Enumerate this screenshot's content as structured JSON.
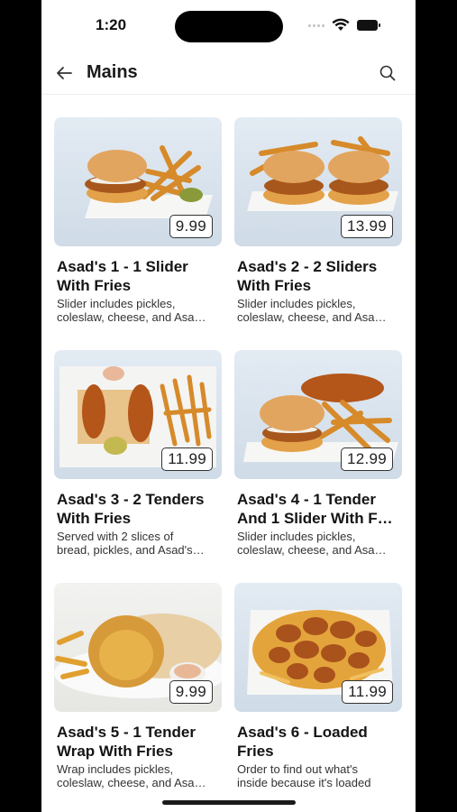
{
  "status_bar": {
    "time": "1:20"
  },
  "header": {
    "title": "Mains"
  },
  "items": [
    {
      "name": "Asad's 1 - 1 Slider\nWith Fries",
      "price": "9.99",
      "description": "Slider includes pickles,\ncoleslaw, cheese, and Asa…"
    },
    {
      "name": "Asad's 2 - 2 Sliders\nWith Fries",
      "price": "13.99",
      "description": "Slider includes pickles,\ncoleslaw, cheese, and Asa…"
    },
    {
      "name": "Asad's 3 - 2 Tenders\nWith Fries",
      "price": "11.99",
      "description": "Served with 2 slices of\nbread, pickles, and Asad's…"
    },
    {
      "name": "Asad's 4 - 1 Tender\nAnd 1 Slider With F…",
      "price": "12.99",
      "description": "Slider includes pickles,\ncoleslaw, cheese, and Asa…"
    },
    {
      "name": "Asad's 5 - 1 Tender\nWrap With Fries",
      "price": "9.99",
      "description": "Wrap includes pickles,\ncoleslaw, cheese, and Asa…"
    },
    {
      "name": "Asad's 6 - Loaded\nFries",
      "price": "11.99",
      "description": "Order to find out what's\ninside because it's loaded"
    }
  ]
}
